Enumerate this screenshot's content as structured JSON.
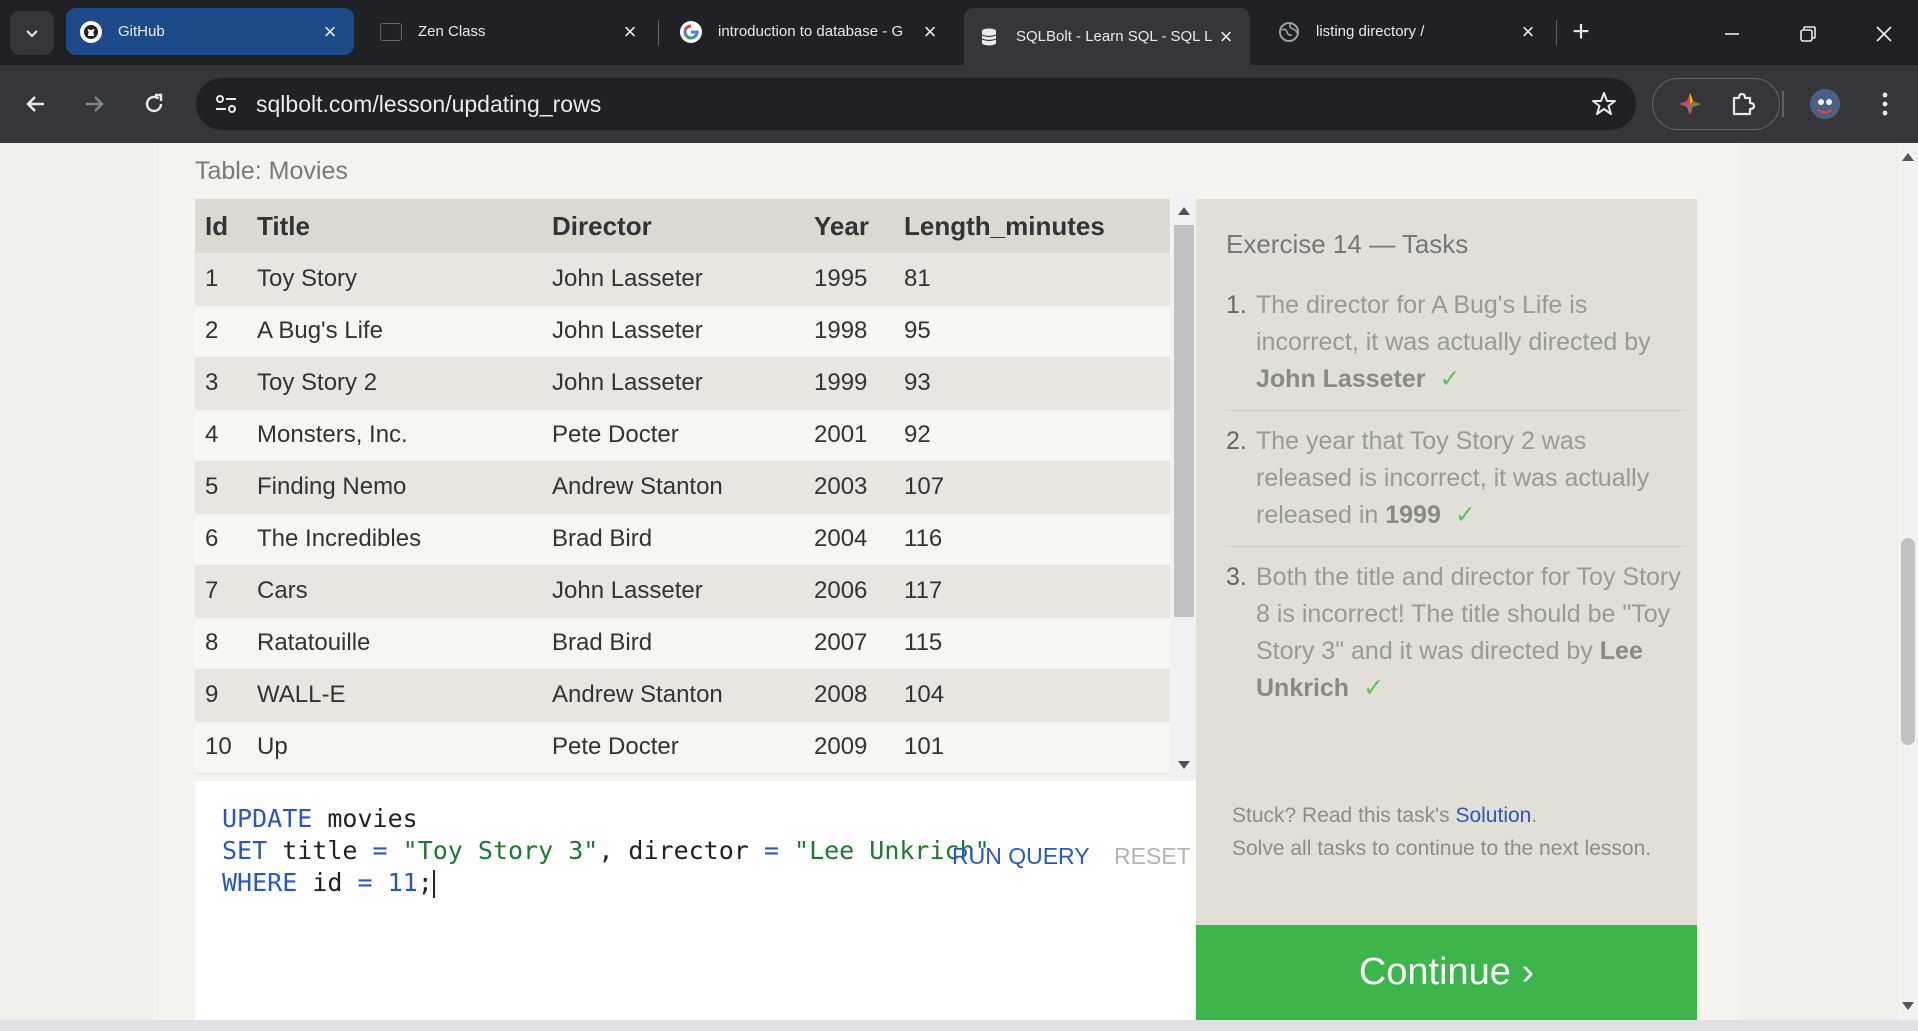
{
  "browser": {
    "tabs": [
      {
        "title": "GitHub",
        "icon": "github-icon"
      },
      {
        "title": "Zen Class",
        "icon": "zen-class-icon"
      },
      {
        "title": "introduction to database - G",
        "icon": "google-icon"
      },
      {
        "title": "SQLBolt - Learn SQL - SQL L",
        "icon": "database-icon"
      },
      {
        "title": "listing directory /",
        "icon": "globe-icon"
      }
    ],
    "url": "sqlbolt.com/lesson/updating_rows",
    "colors": {
      "frame": "#202124",
      "toolbar": "#35363a",
      "github_tab": "#1f4a8a"
    }
  },
  "table": {
    "caption": "Table: Movies",
    "columns": [
      "Id",
      "Title",
      "Director",
      "Year",
      "Length_minutes"
    ],
    "rows": [
      [
        "1",
        "Toy Story",
        "John Lasseter",
        "1995",
        "81"
      ],
      [
        "2",
        "A Bug's Life",
        "John Lasseter",
        "1998",
        "95"
      ],
      [
        "3",
        "Toy Story 2",
        "John Lasseter",
        "1999",
        "93"
      ],
      [
        "4",
        "Monsters, Inc.",
        "Pete Docter",
        "2001",
        "92"
      ],
      [
        "5",
        "Finding Nemo",
        "Andrew Stanton",
        "2003",
        "107"
      ],
      [
        "6",
        "The Incredibles",
        "Brad Bird",
        "2004",
        "116"
      ],
      [
        "7",
        "Cars",
        "John Lasseter",
        "2006",
        "117"
      ],
      [
        "8",
        "Ratatouille",
        "Brad Bird",
        "2007",
        "115"
      ],
      [
        "9",
        "WALL-E",
        "Andrew Stanton",
        "2008",
        "104"
      ],
      [
        "10",
        "Up",
        "Pete Docter",
        "2009",
        "101"
      ]
    ]
  },
  "editor": {
    "line1": {
      "kw": "UPDATE",
      "rest": " movies"
    },
    "line2": {
      "kw": "SET",
      "a": " title ",
      "eq1": "=",
      "s1": "\"Toy Story 3\"",
      "b": ", director ",
      "eq2": "=",
      "s2": "\"Lee Unkrich\""
    },
    "line3": {
      "kw": "WHERE",
      "a": " id ",
      "eq": "=",
      "num": "11",
      "end": ";"
    },
    "run_label": "RUN QUERY",
    "reset_label": "RESET"
  },
  "tasks": {
    "title": "Exercise 14 — Tasks",
    "items": [
      {
        "num": "1.",
        "text": "The director for A Bug's Life is incorrect, it was actually directed by ",
        "bold": "John Lasseter",
        "check": "✓"
      },
      {
        "num": "2.",
        "text": "The year that Toy Story 2 was released is incorrect, it was actually released in ",
        "bold": "1999",
        "check": "✓"
      },
      {
        "num": "3.",
        "text": "Both the title and director for Toy Story 8 is incorrect! The title should be \"Toy Story 3\" and it was directed by ",
        "bold": "Lee Unkrich",
        "check": "✓"
      }
    ],
    "stuck_prefix": "Stuck? Read this task's ",
    "solution_link": "Solution",
    "stuck_suffix": ".",
    "stuck_line2": "Solve all tasks to continue to the next lesson.",
    "continue_label": "Continue ›",
    "colors": {
      "check": "#5cc465",
      "continue": "#3cb64b",
      "link": "#2a56c6"
    }
  }
}
